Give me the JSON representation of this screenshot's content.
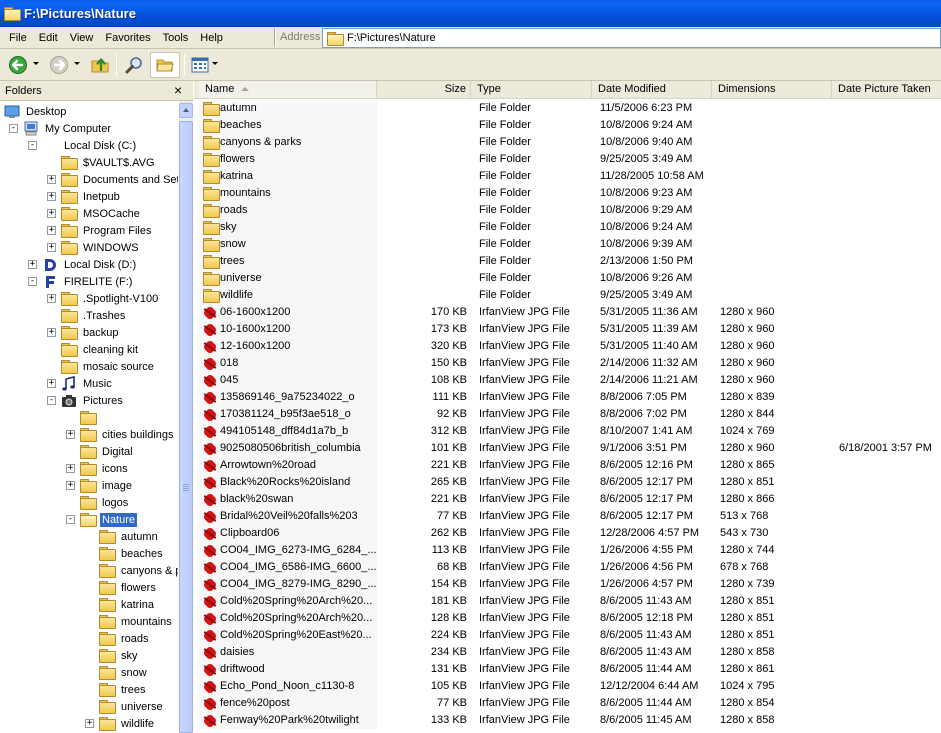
{
  "window": {
    "title": "F:\\Pictures\\Nature"
  },
  "menu": [
    "File",
    "Edit",
    "View",
    "Favorites",
    "Tools",
    "Help"
  ],
  "address": {
    "label": "Address",
    "value": "F:\\Pictures\\Nature"
  },
  "folders_pane": {
    "title": "Folders",
    "close": "×",
    "tree": [
      {
        "label": "Desktop",
        "icon": "desktop-icon",
        "level": 0,
        "exp": ""
      },
      {
        "label": "My Computer",
        "icon": "my-computer-icon",
        "level": 1,
        "exp": "-"
      },
      {
        "label": "Local Disk (C:)",
        "icon": "drive-c-icon",
        "level": 2,
        "exp": "-"
      },
      {
        "label": "$VAULT$.AVG",
        "icon": "folder-icon",
        "level": 3,
        "exp": ""
      },
      {
        "label": "Documents and Sett",
        "icon": "folder-icon",
        "level": 3,
        "exp": "+"
      },
      {
        "label": "Inetpub",
        "icon": "folder-icon",
        "level": 3,
        "exp": "+"
      },
      {
        "label": "MSOCache",
        "icon": "folder-icon",
        "level": 3,
        "exp": "+"
      },
      {
        "label": "Program Files",
        "icon": "folder-icon",
        "level": 3,
        "exp": "+"
      },
      {
        "label": "WINDOWS",
        "icon": "folder-icon",
        "level": 3,
        "exp": "+"
      },
      {
        "label": "Local Disk (D:)",
        "icon": "drive-d-icon",
        "level": 2,
        "exp": "+"
      },
      {
        "label": "FIRELITE (F:)",
        "icon": "drive-f-icon",
        "level": 2,
        "exp": "-"
      },
      {
        "label": ".Spotlight-V100",
        "icon": "folder-icon",
        "level": 3,
        "exp": "+"
      },
      {
        "label": ".Trashes",
        "icon": "folder-icon",
        "level": 3,
        "exp": ""
      },
      {
        "label": "backup",
        "icon": "folder-icon",
        "level": 3,
        "exp": "+"
      },
      {
        "label": "cleaning kit",
        "icon": "folder-icon",
        "level": 3,
        "exp": ""
      },
      {
        "label": "mosaic source",
        "icon": "folder-icon",
        "level": 3,
        "exp": ""
      },
      {
        "label": "Music",
        "icon": "music-folder-icon",
        "level": 3,
        "exp": "+"
      },
      {
        "label": "Pictures",
        "icon": "camera-folder-icon",
        "level": 3,
        "exp": "-"
      },
      {
        "label": "",
        "icon": "folder-icon",
        "level": 4,
        "exp": ""
      },
      {
        "label": "cities buildings",
        "icon": "folder-icon",
        "level": 4,
        "exp": "+"
      },
      {
        "label": "Digital",
        "icon": "folder-icon",
        "level": 4,
        "exp": ""
      },
      {
        "label": "icons",
        "icon": "folder-icon",
        "level": 4,
        "exp": "+"
      },
      {
        "label": "image",
        "icon": "folder-icon",
        "level": 4,
        "exp": "+"
      },
      {
        "label": "logos",
        "icon": "folder-icon",
        "level": 4,
        "exp": ""
      },
      {
        "label": "Nature",
        "icon": "open-folder-icon",
        "level": 4,
        "exp": "-",
        "selected": true
      },
      {
        "label": "autumn",
        "icon": "folder-icon",
        "level": 5,
        "exp": ""
      },
      {
        "label": "beaches",
        "icon": "folder-icon",
        "level": 5,
        "exp": ""
      },
      {
        "label": "canyons & p",
        "icon": "folder-icon",
        "level": 5,
        "exp": ""
      },
      {
        "label": "flowers",
        "icon": "folder-icon",
        "level": 5,
        "exp": ""
      },
      {
        "label": "katrina",
        "icon": "folder-icon",
        "level": 5,
        "exp": ""
      },
      {
        "label": "mountains",
        "icon": "folder-icon",
        "level": 5,
        "exp": ""
      },
      {
        "label": "roads",
        "icon": "folder-icon",
        "level": 5,
        "exp": ""
      },
      {
        "label": "sky",
        "icon": "folder-icon",
        "level": 5,
        "exp": ""
      },
      {
        "label": "snow",
        "icon": "folder-icon",
        "level": 5,
        "exp": ""
      },
      {
        "label": "trees",
        "icon": "folder-icon",
        "level": 5,
        "exp": ""
      },
      {
        "label": "universe",
        "icon": "folder-icon",
        "level": 5,
        "exp": ""
      },
      {
        "label": "wildlife",
        "icon": "folder-icon",
        "level": 5,
        "exp": "+"
      }
    ]
  },
  "columns": {
    "name": "Name",
    "size": "Size",
    "type": "Type",
    "date": "Date Modified",
    "dim": "Dimensions",
    "taken": "Date Picture Taken"
  },
  "files": [
    {
      "icon": "folder-icon",
      "name": "autumn",
      "size": "",
      "type": "File Folder",
      "date": "11/5/2006 6:23 PM",
      "dim": "",
      "taken": ""
    },
    {
      "icon": "folder-icon",
      "name": "beaches",
      "size": "",
      "type": "File Folder",
      "date": "10/8/2006 9:24 AM",
      "dim": "",
      "taken": ""
    },
    {
      "icon": "folder-icon",
      "name": "canyons & parks",
      "size": "",
      "type": "File Folder",
      "date": "10/8/2006 9:40 AM",
      "dim": "",
      "taken": ""
    },
    {
      "icon": "folder-icon",
      "name": "flowers",
      "size": "",
      "type": "File Folder",
      "date": "9/25/2005 3:49 AM",
      "dim": "",
      "taken": ""
    },
    {
      "icon": "folder-icon",
      "name": "katrina",
      "size": "",
      "type": "File Folder",
      "date": "11/28/2005 10:58 AM",
      "dim": "",
      "taken": ""
    },
    {
      "icon": "folder-icon",
      "name": "mountains",
      "size": "",
      "type": "File Folder",
      "date": "10/8/2006 9:23 AM",
      "dim": "",
      "taken": ""
    },
    {
      "icon": "folder-icon",
      "name": "roads",
      "size": "",
      "type": "File Folder",
      "date": "10/8/2006 9:29 AM",
      "dim": "",
      "taken": ""
    },
    {
      "icon": "folder-icon",
      "name": "sky",
      "size": "",
      "type": "File Folder",
      "date": "10/8/2006 9:24 AM",
      "dim": "",
      "taken": ""
    },
    {
      "icon": "folder-icon",
      "name": "snow",
      "size": "",
      "type": "File Folder",
      "date": "10/8/2006 9:39 AM",
      "dim": "",
      "taken": ""
    },
    {
      "icon": "folder-icon",
      "name": "trees",
      "size": "",
      "type": "File Folder",
      "date": "2/13/2006 1:50 PM",
      "dim": "",
      "taken": ""
    },
    {
      "icon": "folder-icon",
      "name": "universe",
      "size": "",
      "type": "File Folder",
      "date": "10/8/2006 9:26 AM",
      "dim": "",
      "taken": ""
    },
    {
      "icon": "folder-icon",
      "name": "wildlife",
      "size": "",
      "type": "File Folder",
      "date": "9/25/2005 3:49 AM",
      "dim": "",
      "taken": ""
    },
    {
      "icon": "irfanview-icon",
      "name": "06-1600x1200",
      "size": "170 KB",
      "type": "IrfanView JPG File",
      "date": "5/31/2005 11:36 AM",
      "dim": "1280 x 960",
      "taken": ""
    },
    {
      "icon": "irfanview-icon",
      "name": "10-1600x1200",
      "size": "173 KB",
      "type": "IrfanView JPG File",
      "date": "5/31/2005 11:39 AM",
      "dim": "1280 x 960",
      "taken": ""
    },
    {
      "icon": "irfanview-icon",
      "name": "12-1600x1200",
      "size": "320 KB",
      "type": "IrfanView JPG File",
      "date": "5/31/2005 11:40 AM",
      "dim": "1280 x 960",
      "taken": ""
    },
    {
      "icon": "irfanview-icon",
      "name": "018",
      "size": "150 KB",
      "type": "IrfanView JPG File",
      "date": "2/14/2006 11:32 AM",
      "dim": "1280 x 960",
      "taken": ""
    },
    {
      "icon": "irfanview-icon",
      "name": "045",
      "size": "108 KB",
      "type": "IrfanView JPG File",
      "date": "2/14/2006 11:21 AM",
      "dim": "1280 x 960",
      "taken": ""
    },
    {
      "icon": "irfanview-icon",
      "name": "135869146_9a75234022_o",
      "size": "111 KB",
      "type": "IrfanView JPG File",
      "date": "8/8/2006 7:05 PM",
      "dim": "1280 x 839",
      "taken": ""
    },
    {
      "icon": "irfanview-icon",
      "name": "170381124_b95f3ae518_o",
      "size": "92 KB",
      "type": "IrfanView JPG File",
      "date": "8/8/2006 7:02 PM",
      "dim": "1280 x 844",
      "taken": ""
    },
    {
      "icon": "irfanview-icon",
      "name": "494105148_dff84d1a7b_b",
      "size": "312 KB",
      "type": "IrfanView JPG File",
      "date": "8/10/2007 1:41 AM",
      "dim": "1024 x 769",
      "taken": ""
    },
    {
      "icon": "irfanview-icon",
      "name": "9025080506british_columbia",
      "size": "101 KB",
      "type": "IrfanView JPG File",
      "date": "9/1/2006 3:51 PM",
      "dim": "1280 x 960",
      "taken": "6/18/2001 3:57 PM"
    },
    {
      "icon": "irfanview-icon",
      "name": "Arrowtown%20road",
      "size": "221 KB",
      "type": "IrfanView JPG File",
      "date": "8/6/2005 12:16 PM",
      "dim": "1280 x 865",
      "taken": ""
    },
    {
      "icon": "irfanview-icon",
      "name": "Black%20Rocks%20island",
      "size": "265 KB",
      "type": "IrfanView JPG File",
      "date": "8/6/2005 12:17 PM",
      "dim": "1280 x 851",
      "taken": ""
    },
    {
      "icon": "irfanview-icon",
      "name": "black%20swan",
      "size": "221 KB",
      "type": "IrfanView JPG File",
      "date": "8/6/2005 12:17 PM",
      "dim": "1280 x 866",
      "taken": ""
    },
    {
      "icon": "irfanview-icon",
      "name": "Bridal%20Veil%20falls%203",
      "size": "77 KB",
      "type": "IrfanView JPG File",
      "date": "8/6/2005 12:17 PM",
      "dim": "513 x 768",
      "taken": ""
    },
    {
      "icon": "irfanview-icon",
      "name": "Clipboard06",
      "size": "262 KB",
      "type": "IrfanView JPG File",
      "date": "12/28/2006 4:57 PM",
      "dim": "543 x 730",
      "taken": ""
    },
    {
      "icon": "irfanview-icon",
      "name": "CO04_IMG_6273-IMG_6284_...",
      "size": "113 KB",
      "type": "IrfanView JPG File",
      "date": "1/26/2006 4:55 PM",
      "dim": "1280 x 744",
      "taken": ""
    },
    {
      "icon": "irfanview-icon",
      "name": "CO04_IMG_6586-IMG_6600_...",
      "size": "68 KB",
      "type": "IrfanView JPG File",
      "date": "1/26/2006 4:56 PM",
      "dim": "678 x 768",
      "taken": ""
    },
    {
      "icon": "irfanview-icon",
      "name": "CO04_IMG_8279-IMG_8290_...",
      "size": "154 KB",
      "type": "IrfanView JPG File",
      "date": "1/26/2006 4:57 PM",
      "dim": "1280 x 739",
      "taken": ""
    },
    {
      "icon": "irfanview-icon",
      "name": "Cold%20Spring%20Arch%20...",
      "size": "181 KB",
      "type": "IrfanView JPG File",
      "date": "8/6/2005 11:43 AM",
      "dim": "1280 x 851",
      "taken": ""
    },
    {
      "icon": "irfanview-icon",
      "name": "Cold%20Spring%20Arch%20...",
      "size": "128 KB",
      "type": "IrfanView JPG File",
      "date": "8/6/2005 12:18 PM",
      "dim": "1280 x 851",
      "taken": ""
    },
    {
      "icon": "irfanview-icon",
      "name": "Cold%20Spring%20East%20...",
      "size": "224 KB",
      "type": "IrfanView JPG File",
      "date": "8/6/2005 11:43 AM",
      "dim": "1280 x 851",
      "taken": ""
    },
    {
      "icon": "irfanview-icon",
      "name": "daisies",
      "size": "234 KB",
      "type": "IrfanView JPG File",
      "date": "8/6/2005 11:43 AM",
      "dim": "1280 x 858",
      "taken": ""
    },
    {
      "icon": "irfanview-icon",
      "name": "driftwood",
      "size": "131 KB",
      "type": "IrfanView JPG File",
      "date": "8/6/2005 11:44 AM",
      "dim": "1280 x 861",
      "taken": ""
    },
    {
      "icon": "irfanview-icon",
      "name": "Echo_Pond_Noon_c1130-8",
      "size": "105 KB",
      "type": "IrfanView JPG File",
      "date": "12/12/2004 6:44 AM",
      "dim": "1024 x 795",
      "taken": ""
    },
    {
      "icon": "irfanview-icon",
      "name": "fence%20post",
      "size": "77 KB",
      "type": "IrfanView JPG File",
      "date": "8/6/2005 11:44 AM",
      "dim": "1280 x 854",
      "taken": ""
    },
    {
      "icon": "irfanview-icon",
      "name": "Fenway%20Park%20twilight",
      "size": "133 KB",
      "type": "IrfanView JPG File",
      "date": "8/6/2005 11:45 AM",
      "dim": "1280 x 858",
      "taken": ""
    }
  ]
}
